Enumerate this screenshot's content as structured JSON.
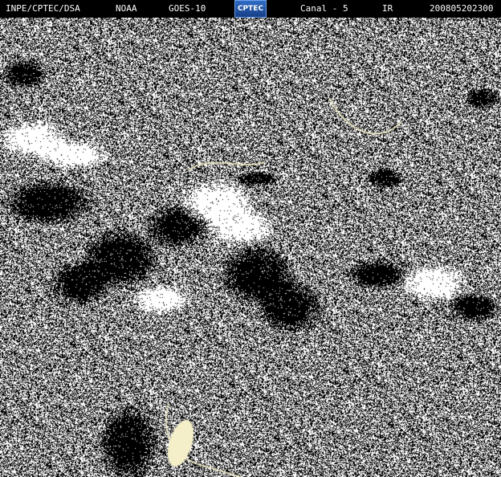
{
  "header": {
    "institution": "INPE/CPTEC/DSA",
    "agency": "NOAA",
    "satellite": "GOES-10",
    "logo_text": "CPTEC",
    "channel": "Canal - 5",
    "band": "IR",
    "timestamp": "200805202300"
  },
  "colors": {
    "background": "#000000",
    "header_text": "#ffffff",
    "cloud_white": "#ffffff",
    "coastline": "#f4efc8",
    "logo_blue": "#2f6cc4"
  }
}
